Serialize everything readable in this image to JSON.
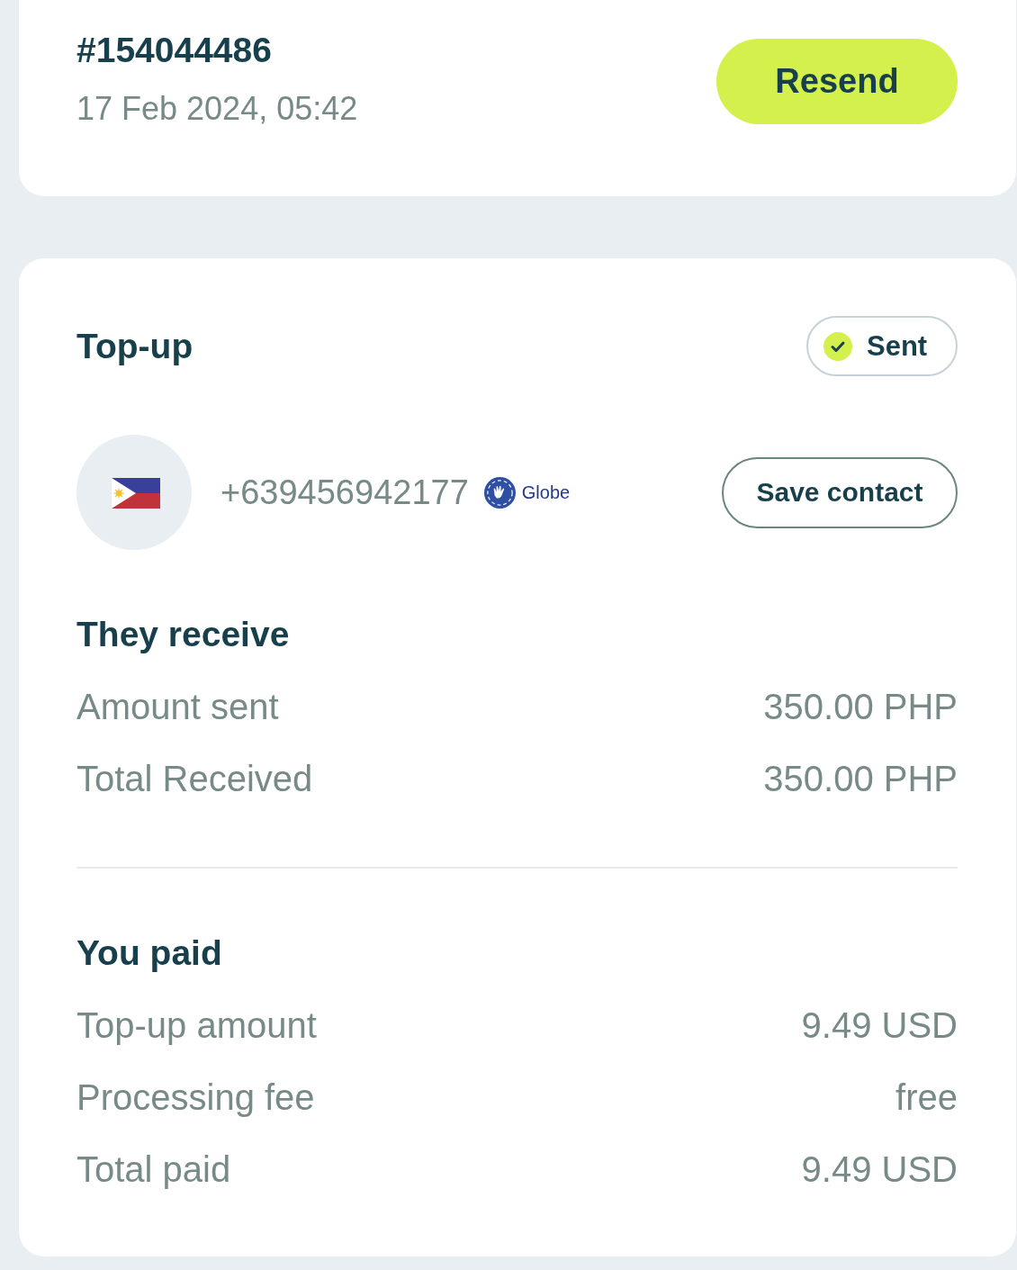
{
  "order_card": {
    "order_number": "#154044486",
    "date": "17 Feb 2024, 05:42",
    "resend_button": "Resend"
  },
  "topup_card": {
    "title": "Top-up",
    "status_badge": {
      "label": "Sent",
      "kind": "sent"
    },
    "contact": {
      "phone": "+639456942177",
      "operator": "Globe",
      "save_button": "Save contact"
    },
    "sections": [
      {
        "title": "They receive",
        "rows": [
          {
            "label": "Amount sent",
            "value": "350.00 PHP"
          },
          {
            "label": "Total Received",
            "value": "350.00 PHP"
          }
        ]
      },
      {
        "title": "You paid",
        "rows": [
          {
            "label": "Top-up amount",
            "value": "9.49 USD"
          },
          {
            "label": "Processing fee",
            "value": "free"
          },
          {
            "label": "Total paid",
            "value": "9.49 USD"
          }
        ]
      }
    ]
  }
}
